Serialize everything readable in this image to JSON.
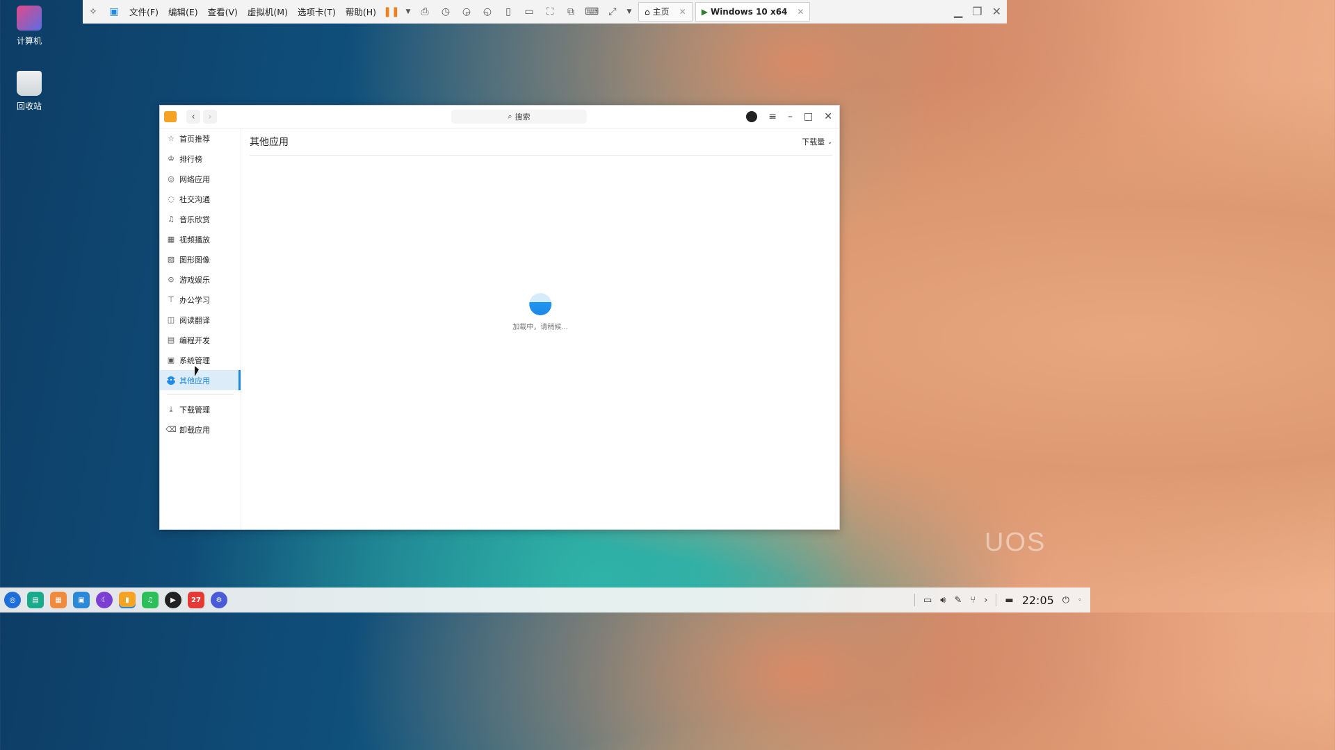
{
  "desktop": {
    "icons": [
      {
        "label": "计算机"
      },
      {
        "label": "回收站"
      }
    ],
    "watermark": "UOS"
  },
  "vmware": {
    "menu": [
      "文件(F)",
      "编辑(E)",
      "查看(V)",
      "虚拟机(M)",
      "选项卡(T)",
      "帮助(H)"
    ],
    "tabs": [
      {
        "label": "主页"
      },
      {
        "label": "Windows 10 x64"
      }
    ]
  },
  "app": {
    "search_placeholder": "搜索",
    "sidebar": {
      "items": [
        {
          "label": "首页推荐",
          "icon": "star-icon"
        },
        {
          "label": "排行榜",
          "icon": "crown-icon"
        },
        {
          "label": "网络应用",
          "icon": "globe-icon"
        },
        {
          "label": "社交沟通",
          "icon": "chat-icon"
        },
        {
          "label": "音乐欣赏",
          "icon": "music-icon"
        },
        {
          "label": "视频播放",
          "icon": "film-icon"
        },
        {
          "label": "图形图像",
          "icon": "image-icon"
        },
        {
          "label": "游戏娱乐",
          "icon": "gamepad-icon"
        },
        {
          "label": "办公学习",
          "icon": "presentation-icon"
        },
        {
          "label": "阅读翻译",
          "icon": "book-icon"
        },
        {
          "label": "编程开发",
          "icon": "terminal-icon"
        },
        {
          "label": "系统管理",
          "icon": "settings-icon"
        },
        {
          "label": "其他应用",
          "icon": "more-icon",
          "active": true
        }
      ],
      "bottom_items": [
        {
          "label": "下载管理",
          "icon": "download-icon"
        },
        {
          "label": "卸载应用",
          "icon": "trash-icon"
        }
      ]
    },
    "content": {
      "title": "其他应用",
      "sort_label": "下载量",
      "loading_text": "加载中，请稍候..."
    }
  },
  "taskbar": {
    "clock": "22:05",
    "calendar_day": "27"
  }
}
